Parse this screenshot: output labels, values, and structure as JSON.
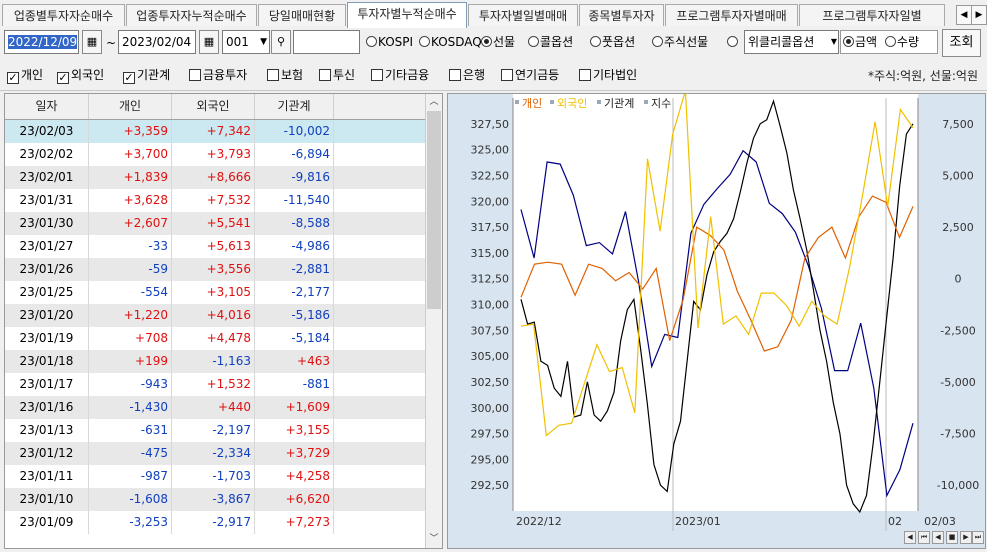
{
  "tabs": [
    "업종별투자자순매수",
    "업종투자자누적순매수",
    "당일매매현황",
    "투자자별누적순매수",
    "투자자별일별매매",
    "종목별투자자",
    "프로그램투자자별매매",
    "프로그램투자자일별"
  ],
  "active_tab_index": 3,
  "filters": {
    "start_date": "2022/12/09",
    "end_date": "2023/02/04",
    "code": "001",
    "search_value": "",
    "radios": [
      {
        "label": "KOSPI",
        "checked": false
      },
      {
        "label": "KOSDAQ",
        "checked": false
      },
      {
        "label": "선물",
        "checked": true
      },
      {
        "label": "콜옵션",
        "checked": false
      },
      {
        "label": "풋옵션",
        "checked": false
      },
      {
        "label": "주식선물",
        "checked": false
      },
      {
        "label": "",
        "checked": false
      }
    ],
    "weekly_select": "위클리콜옵션",
    "unit_radios": [
      {
        "label": "금액",
        "checked": true
      },
      {
        "label": "수량",
        "checked": false
      }
    ],
    "query_button": "조회"
  },
  "investors": [
    {
      "label": "개인",
      "checked": true
    },
    {
      "label": "외국인",
      "checked": true
    },
    {
      "label": "기관계",
      "checked": true
    },
    {
      "label": "금융투자",
      "checked": false
    },
    {
      "label": "보험",
      "checked": false
    },
    {
      "label": "투신",
      "checked": false
    },
    {
      "label": "기타금융",
      "checked": false
    },
    {
      "label": "은행",
      "checked": false
    },
    {
      "label": "연기금등",
      "checked": false
    },
    {
      "label": "기타법인",
      "checked": false
    }
  ],
  "unit_note": "*주식:억원, 선물:억원",
  "table": {
    "columns": [
      "일자",
      "개인",
      "외국인",
      "기관계"
    ],
    "rows": [
      [
        "23/02/03",
        "+3,359",
        "+7,342",
        "-10,002"
      ],
      [
        "23/02/02",
        "+3,700",
        "+3,793",
        "-6,894"
      ],
      [
        "23/02/01",
        "+1,839",
        "+8,666",
        "-9,816"
      ],
      [
        "23/01/31",
        "+3,628",
        "+7,532",
        "-11,540"
      ],
      [
        "23/01/30",
        "+2,607",
        "+5,541",
        "-8,588"
      ],
      [
        "23/01/27",
        "-33",
        "+5,613",
        "-4,986"
      ],
      [
        "23/01/26",
        "-59",
        "+3,556",
        "-2,881"
      ],
      [
        "23/01/25",
        "-554",
        "+3,105",
        "-2,177"
      ],
      [
        "23/01/20",
        "+1,220",
        "+4,016",
        "-5,186"
      ],
      [
        "23/01/19",
        "+708",
        "+4,478",
        "-5,184"
      ],
      [
        "23/01/18",
        "+199",
        "-1,163",
        "+463"
      ],
      [
        "23/01/17",
        "-943",
        "+1,532",
        "-881"
      ],
      [
        "23/01/16",
        "-1,430",
        "+440",
        "+1,609"
      ],
      [
        "23/01/13",
        "-631",
        "-2,197",
        "+3,155"
      ],
      [
        "23/01/12",
        "-475",
        "-2,334",
        "+3,729"
      ],
      [
        "23/01/11",
        "-987",
        "-1,703",
        "+4,258"
      ],
      [
        "23/01/10",
        "-1,608",
        "-3,867",
        "+6,620"
      ],
      [
        "23/01/09",
        "-3,253",
        "-2,917",
        "+7,273"
      ]
    ]
  },
  "colors": {
    "personal": "#e06000",
    "foreign": "#f0c000",
    "institution": "#000000",
    "index": "#000080",
    "positive": "#e01010",
    "negative": "#1040c0"
  },
  "chart_data": {
    "type": "line",
    "legend": [
      "개인",
      "외국인",
      "기관계",
      "지수"
    ],
    "x_labels": [
      "2022/12",
      "2023/01",
      "02",
      "02/03"
    ],
    "left_axis_ticks": [
      "327,50",
      "325,00",
      "322,50",
      "320,00",
      "317,50",
      "315,00",
      "312,50",
      "310,00",
      "307,50",
      "305,00",
      "302,50",
      "300,00",
      "297,50",
      "295,00",
      "292,50"
    ],
    "right_axis_ticks": [
      "7,500",
      "5,000",
      "2,500",
      "0",
      "-2,500",
      "-5,000",
      "-7,500",
      "-10,000"
    ],
    "left_ylim": [
      290.0,
      330.0
    ],
    "right_ylim": [
      -11250,
      8750
    ],
    "series": [
      {
        "name": "지수",
        "axis": "left",
        "values": [
          319.2,
          314.5,
          323.8,
          323.6,
          320.6,
          315.7,
          316.0,
          314.9,
          319.0,
          312.2,
          304.0,
          307.1,
          306.8,
          316.9,
          319.7,
          321.2,
          322.6,
          324.9,
          323.8,
          319.8,
          318.8,
          317.0,
          313.7,
          309.6,
          303.6,
          303.6,
          308.2,
          301.9,
          291.5,
          294.0,
          298.5
        ]
      },
      {
        "name": "기관계",
        "axis": "right",
        "values": [
          -1000,
          -2200,
          -2100,
          -4000,
          -4200,
          -5300,
          -5700,
          -4000,
          -6700,
          -6600,
          -5000,
          -6600,
          -6900,
          -6400,
          -5500,
          -3000,
          -1500,
          -1000,
          -3400,
          -6000,
          -9000,
          -10000,
          -10300,
          -8000,
          -6900,
          -4000,
          -1100,
          -1500,
          200,
          1300,
          1800,
          2200,
          2900,
          4200,
          5600,
          6800,
          7500,
          7700,
          8600,
          7400,
          6100,
          4300,
          2900,
          1400,
          -500,
          -2500,
          -4000,
          -6000,
          -7500,
          -10000,
          -10900,
          -11300,
          -10500,
          -8000,
          -5000,
          -2000,
          1000,
          4500,
          7000,
          7500
        ]
      },
      {
        "name": "개인",
        "axis": "right",
        "values": [
          -900,
          700,
          800,
          700,
          -800,
          700,
          500,
          -100,
          300,
          -500,
          500,
          -3000,
          -1000,
          2500,
          2100,
          1400,
          -600,
          -2000,
          -3500,
          -3300,
          -2000,
          1000,
          2000,
          2500,
          1000,
          3000,
          4000,
          3700,
          2000,
          3500
        ]
      },
      {
        "name": "외국인",
        "axis": "right",
        "values": [
          -2300,
          -2200,
          -7600,
          -7100,
          -7000,
          -5100,
          -3200,
          -4500,
          -4300,
          -6500,
          5800,
          2300,
          7000,
          9100,
          -2400,
          3000,
          -2200,
          -1800,
          -2700,
          -700,
          -700,
          -1300,
          -2300,
          -1100,
          -1800,
          -2200,
          600,
          4000,
          7600,
          3500,
          8200,
          7300
        ]
      }
    ]
  }
}
